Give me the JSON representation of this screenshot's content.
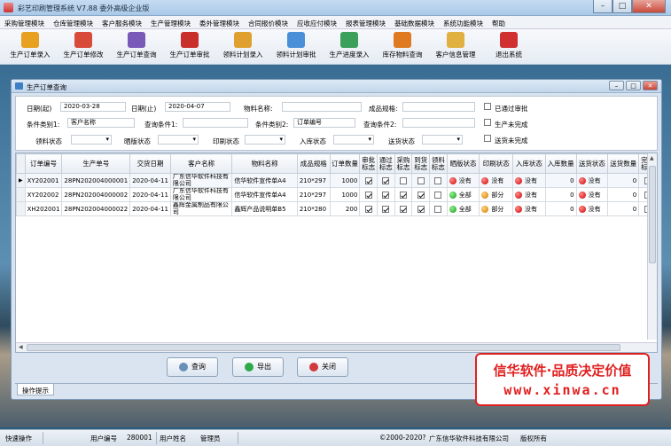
{
  "app": {
    "title": "彩艺印刷管理系统  V7.88  委外高级企业版"
  },
  "menu": [
    "采购管理模块",
    "仓库管理模块",
    "客户服务模块",
    "生产管理模块",
    "委外管理模块",
    "合同报价模块",
    "应收应付模块",
    "报表管理模块",
    "基础数据模块",
    "系统功能模块",
    "帮助"
  ],
  "toolbar": [
    {
      "label": "生产订单录入",
      "color": "#e8a020"
    },
    {
      "label": "生产订单修改",
      "color": "#d84a3a"
    },
    {
      "label": "生产订单查询",
      "color": "#7a5ab8"
    },
    {
      "label": "生产订单审批",
      "color": "#c9302c"
    },
    {
      "label": "领料计划录入",
      "color": "#e0a030"
    },
    {
      "label": "领料计划审批",
      "color": "#4a90d9"
    },
    {
      "label": "生产进度录入",
      "color": "#3aa05a"
    },
    {
      "label": "库存物料查询",
      "color": "#e07a20"
    },
    {
      "label": "客户信息管理",
      "color": "#e0b040"
    },
    {
      "label": "退出系统",
      "color": "#d03030"
    }
  ],
  "window": {
    "title": "生产订单查询"
  },
  "form": {
    "date_start_label": "日期(起)",
    "date_start": "2020-03-28",
    "date_end_label": "日期(止)",
    "date_end": "2020-04-07",
    "material_label": "物料名称:",
    "material": "",
    "spec_label": "成品规格:",
    "spec": "",
    "cond_type1_label": "条件类别1:",
    "cond_type1": "客户名称",
    "cond1_label": "查询条件1:",
    "cond1": "",
    "cond_type2_label": "条件类别2:",
    "cond_type2": "订单编号",
    "cond2_label": "查询条件2:",
    "cond2": "",
    "chk_approved": "已通过审批",
    "chk_unfinished": "生产未完成",
    "chk_unshipped": "送货未完成",
    "status_labels": [
      "领料状态",
      "晒版状态",
      "印刷状态",
      "入库状态",
      "送货状态"
    ]
  },
  "table": {
    "headers": [
      "订单编号",
      "生产单号",
      "交货日期",
      "客户名称",
      "物料名称",
      "成品规格",
      "订单数量",
      "审批标志",
      "通过标志",
      "采购标志",
      "到货标志",
      "领料标志",
      "晒版状态",
      "印刷状态",
      "入库状态",
      "入库数量",
      "送货状态",
      "送货数量",
      "完结标志"
    ],
    "rows": [
      {
        "order": "XY202001",
        "prod": "28PN202004000001",
        "date": "2020-04-11",
        "customer": "广东信华软件科技有限公司",
        "material": "信华软件宣传单A4",
        "spec": "210*297",
        "qty": "1000",
        "approve": true,
        "pass": true,
        "purchase": false,
        "arrive": false,
        "pick": false,
        "plate": {
          "dot": "dred",
          "text": "没有"
        },
        "print": {
          "dot": "dred",
          "text": "没有"
        },
        "stock": {
          "dot": "dred",
          "text": "没有"
        },
        "stock_qty": "0",
        "ship": {
          "dot": "dred",
          "text": "没有"
        },
        "ship_qty": "0",
        "done": false
      },
      {
        "order": "XY202002",
        "prod": "28PN202004000002",
        "date": "2020-04-11",
        "customer": "广东信华软件科技有限公司",
        "material": "信华软件宣传单A4",
        "spec": "210*297",
        "qty": "1000",
        "approve": true,
        "pass": true,
        "purchase": true,
        "arrive": true,
        "pick": false,
        "plate": {
          "dot": "dgrn",
          "text": "全部"
        },
        "print": {
          "dot": "dorg",
          "text": "部分"
        },
        "stock": {
          "dot": "dred",
          "text": "没有"
        },
        "stock_qty": "0",
        "ship": {
          "dot": "dred",
          "text": "没有"
        },
        "ship_qty": "0",
        "done": false
      },
      {
        "order": "XH202001",
        "prod": "28PN202004000022",
        "date": "2020-04-11",
        "customer": "鑫辉金属制品有限公司",
        "material": "鑫辉产品说明单B5",
        "spec": "210*280",
        "qty": "200",
        "approve": true,
        "pass": true,
        "purchase": true,
        "arrive": true,
        "pick": false,
        "plate": {
          "dot": "dgrn",
          "text": "全部"
        },
        "print": {
          "dot": "dorg",
          "text": "部分"
        },
        "stock": {
          "dot": "dred",
          "text": "没有"
        },
        "stock_qty": "0",
        "ship": {
          "dot": "dred",
          "text": "没有"
        },
        "ship_qty": "0",
        "done": false
      }
    ]
  },
  "buttons": {
    "query": "查询",
    "export": "导出",
    "close": "关闭"
  },
  "tab": "操作提示",
  "ad": {
    "line1": "信华软件·品质决定价值",
    "line2": "www.xinwa.cn"
  },
  "status": {
    "quick": "快速操作",
    "user_no_label": "用户编号",
    "user_no": "280001",
    "user_name_label": "用户姓名",
    "user_name": "管理员",
    "copyright": "©2000-2020?",
    "company": "广东信华软件科技有限公司",
    "rights": "版权所有"
  }
}
